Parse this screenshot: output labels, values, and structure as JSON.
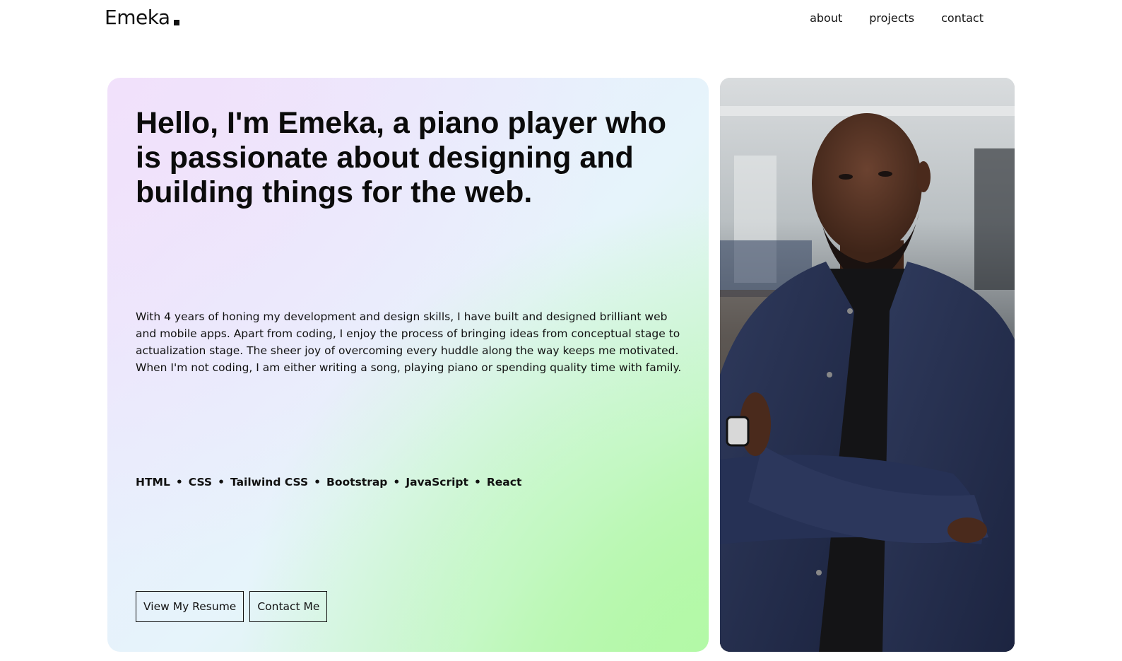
{
  "nav": {
    "logo": "Emeka",
    "links": [
      "about",
      "projects",
      "contact"
    ]
  },
  "hero": {
    "headline": "Hello, I'm Emeka, a piano player who is passionate about designing and building things for the web.",
    "bio": "With 4 years of honing my development and design skills, I have built and designed brilliant web and mobile apps. Apart from coding, I enjoy the process of bringing ideas from conceptual stage to actualization stage. The sheer joy of overcoming every huddle along the way keeps me motivated. When I'm not coding, I am either writing a song, playing piano or spending quality time with family.",
    "skills": [
      "HTML",
      "CSS",
      "Tailwind CSS",
      "Bootstrap",
      "JavaScript",
      "React"
    ],
    "skill_separator": "•",
    "buttons": {
      "resume": "View My Resume",
      "contact": "Contact Me"
    }
  },
  "colors": {
    "text": "#111111",
    "gradient_start": "#efe4fb",
    "gradient_mid": "#e6f4fb",
    "gradient_end": "#b7f6a8",
    "suit": "#26304f"
  }
}
